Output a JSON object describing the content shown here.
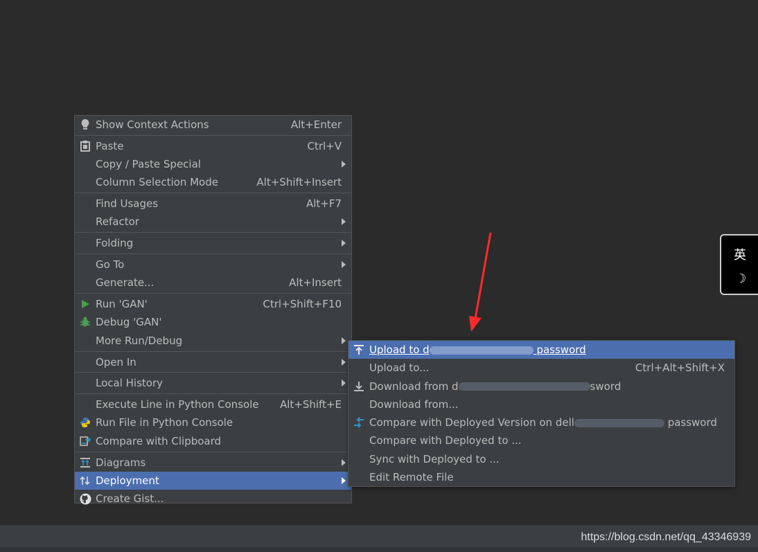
{
  "colors": {
    "background": "#2b2b2b",
    "menu_bg": "#3c3f41",
    "selected_bg": "#4b6eaf",
    "text": "#bbbbbb",
    "annotation": "#ff2a2a"
  },
  "main_menu": {
    "show_context_actions": {
      "label": "Show Context Actions",
      "shortcut": "Alt+Enter",
      "icon": "lightbulb-icon"
    },
    "paste": {
      "label": "Paste",
      "shortcut": "Ctrl+V",
      "icon": "clipboard-icon"
    },
    "copy_paste_special": {
      "label": "Copy / Paste Special"
    },
    "column_selection_mode": {
      "label": "Column Selection Mode",
      "shortcut": "Alt+Shift+Insert"
    },
    "find_usages": {
      "label": "Find Usages",
      "shortcut": "Alt+F7"
    },
    "refactor": {
      "label": "Refactor"
    },
    "folding": {
      "label": "Folding"
    },
    "go_to": {
      "label": "Go To"
    },
    "generate": {
      "label": "Generate...",
      "shortcut": "Alt+Insert"
    },
    "run": {
      "label": "Run 'GAN'",
      "shortcut": "Ctrl+Shift+F10",
      "icon": "run-triangle-icon"
    },
    "debug": {
      "label": "Debug 'GAN'",
      "icon": "bug-icon"
    },
    "more_run_debug": {
      "label": "More Run/Debug"
    },
    "open_in": {
      "label": "Open In"
    },
    "local_history": {
      "label": "Local History"
    },
    "execute_line": {
      "label": "Execute Line in Python Console",
      "shortcut": "Alt+Shift+E"
    },
    "run_file": {
      "label": "Run File in Python Console",
      "icon": "python-icon"
    },
    "compare_clipboard": {
      "label": "Compare with Clipboard",
      "icon": "compare-icon"
    },
    "diagrams": {
      "label": "Diagrams",
      "icon": "diagram-icon"
    },
    "deployment": {
      "label": "Deployment",
      "icon": "deployment-icon"
    },
    "create_gist": {
      "label": "Create Gist...",
      "icon": "github-icon"
    }
  },
  "sub_menu": {
    "upload_to_server": {
      "prefix": "Upload to d",
      "suffix": "password",
      "icon": "upload-icon"
    },
    "upload_to": {
      "label": "Upload to...",
      "shortcut": "Ctrl+Alt+Shift+X"
    },
    "download_from_server": {
      "prefix": "Download from d",
      "suffix": "sword",
      "icon": "download-icon"
    },
    "download_from": {
      "label": "Download from..."
    },
    "compare_deployed": {
      "prefix": "Compare with Deployed Version on dell",
      "suffix": "password",
      "icon": "compare-arrows-icon"
    },
    "compare_deployed_to": {
      "label": "Compare with Deployed to ..."
    },
    "sync_deployed": {
      "label": "Sync with Deployed to ..."
    },
    "edit_remote": {
      "label": "Edit Remote File"
    }
  },
  "ime_indicator": {
    "char": "英",
    "moon": "☽"
  },
  "watermark": "https://blog.csdn.net/qq_43346939"
}
